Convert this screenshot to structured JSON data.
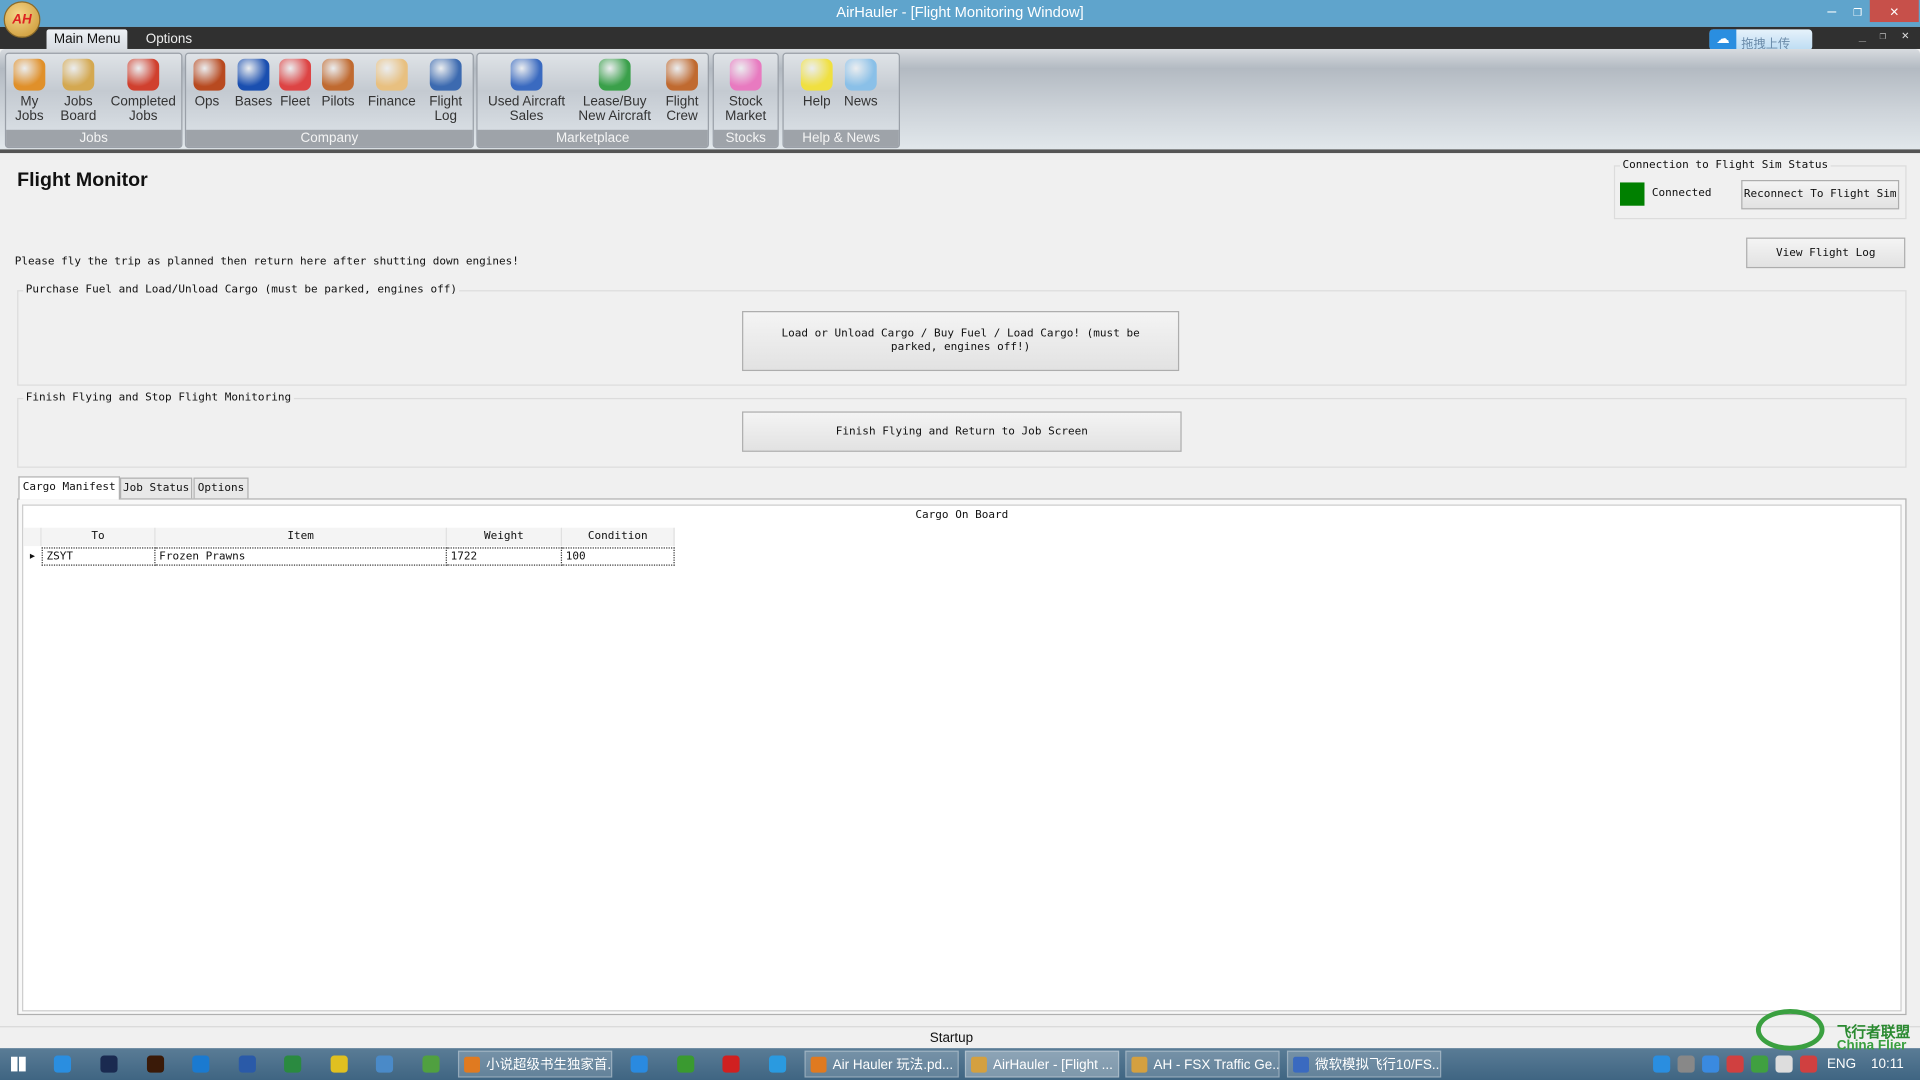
{
  "window": {
    "title": "AirHauler - [Flight Monitoring Window]",
    "logo_text": "AH",
    "minimize": "–",
    "restore": "❐",
    "close": "✕"
  },
  "menu": {
    "tabs": [
      "Main Menu",
      "Options"
    ],
    "upload_label": "拖拽上传"
  },
  "ribbon": {
    "groups": [
      {
        "label": "Jobs",
        "items": [
          {
            "label": "My Jobs",
            "icon": "plane-icon",
            "color": "#e0902a"
          },
          {
            "label": "Jobs Board",
            "icon": "box-icon",
            "color": "#d4a850"
          },
          {
            "label": "Completed Jobs",
            "icon": "checkmark-icon",
            "color": "#d0402e"
          }
        ]
      },
      {
        "label": "Company",
        "items": [
          {
            "label": "Ops",
            "icon": "operator-icon",
            "color": "#b84a20"
          },
          {
            "label": "Bases",
            "icon": "globe-icon",
            "color": "#1a4fb0"
          },
          {
            "label": "Fleet",
            "icon": "airplane-icon",
            "color": "#d44"
          },
          {
            "label": "Pilots",
            "icon": "pilot-icon",
            "color": "#c06a30"
          },
          {
            "label": "Finance",
            "icon": "money-icon",
            "color": "#e8c080"
          },
          {
            "label": "Flight Log",
            "icon": "book-icon",
            "color": "#3c6ab0"
          }
        ]
      },
      {
        "label": "Marketplace",
        "items": [
          {
            "label": "Used Aircraft Sales",
            "icon": "card-icon",
            "color": "#3a6ac0"
          },
          {
            "label": "Lease/Buy New Aircraft",
            "icon": "keys-icon",
            "color": "#3aa04a"
          },
          {
            "label": "Flight Crew",
            "icon": "crew-icon",
            "color": "#c06a30"
          }
        ]
      },
      {
        "label": "Stocks",
        "items": [
          {
            "label": "Stock Market",
            "icon": "bar-chart-icon",
            "color": "#e87ac0"
          }
        ]
      },
      {
        "label": "Help & News",
        "items": [
          {
            "label": "Help",
            "icon": "lightbulb-icon",
            "color": "#f0e040"
          },
          {
            "label": "News",
            "icon": "notepad-icon",
            "color": "#8ac0e8"
          }
        ]
      }
    ]
  },
  "main": {
    "title": "Flight Monitor",
    "connection": {
      "legend": "Connection to Flight Sim Status",
      "status": "Connected",
      "status_color": "#008000",
      "reconnect": "Reconnect To Flight Sim"
    },
    "view_flight_log": "View Flight Log",
    "instruction": "Please fly the trip as planned then return here after shutting down engines!",
    "fuel_group": {
      "legend": "Purchase Fuel and Load/Unload Cargo (must be parked, engines off)",
      "button": "Load or Unload Cargo / Buy Fuel / Load Cargo!  (must be parked, engines off!)"
    },
    "finish_group": {
      "legend": "Finish Flying and Stop Flight Monitoring",
      "button": "Finish Flying and Return to Job Screen"
    },
    "tabs": [
      "Cargo Manifest",
      "Job Status",
      "Options"
    ],
    "grid": {
      "caption": "Cargo On Board",
      "columns": [
        "To",
        "Item",
        "Weight",
        "Condition"
      ],
      "rows": [
        [
          "ZSYT",
          "Frozen Prawns",
          "1722",
          "100"
        ]
      ]
    }
  },
  "status": "Startup",
  "taskbar": {
    "items": [
      "小说超级书生独家首...",
      "Air Hauler  玩法.pd...",
      "AirHauler - [Flight ...",
      "AH - FSX Traffic Ge...",
      "微软模拟飞行10/FS..."
    ],
    "lang": "ENG",
    "clock": "10:11"
  },
  "watermark": {
    "cn": "飞行者联盟",
    "en": "China Flier"
  }
}
